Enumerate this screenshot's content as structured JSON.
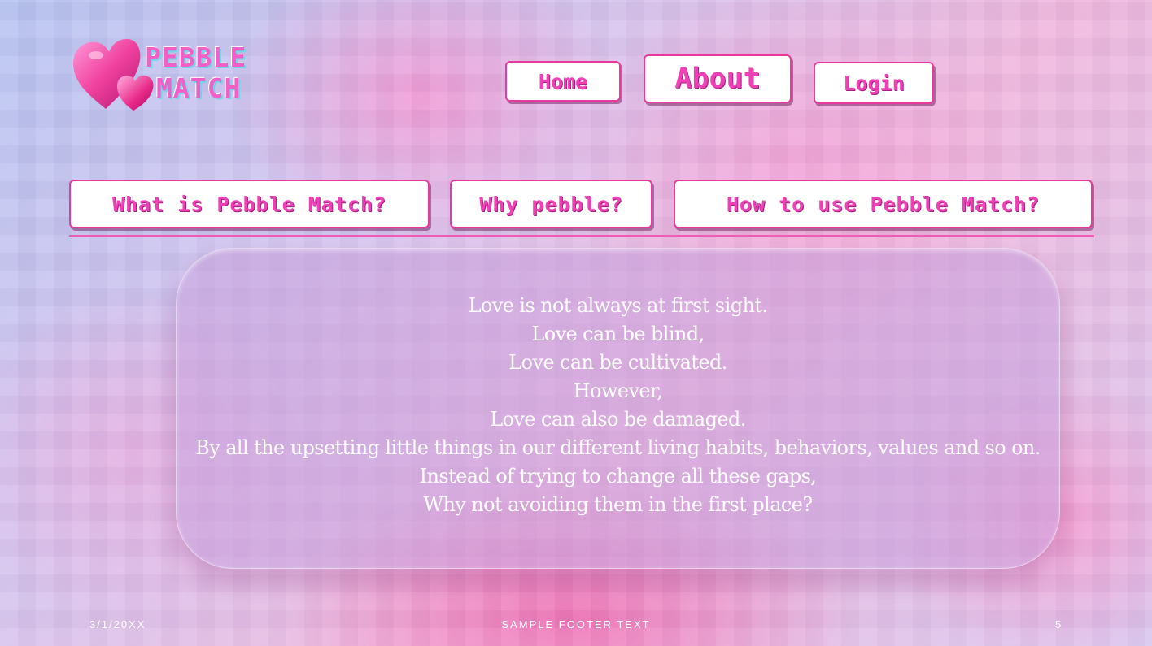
{
  "logo": {
    "line1": "PEBBLE",
    "line2": "MATCH",
    "icon": "double-heart-icon"
  },
  "nav": {
    "home": "Home",
    "about": "About",
    "login": "Login"
  },
  "tabs": [
    {
      "label": "What is Pebble Match?"
    },
    {
      "label": "Why pebble?"
    },
    {
      "label": "How to use Pebble Match?"
    }
  ],
  "poem": [
    "Love is not always at first sight.",
    "Love can be blind,",
    "Love can be cultivated.",
    "However,",
    "Love can also be damaged.",
    "By all the upsetting little things in our different living habits, behaviors, values and so on.",
    "Instead of trying to change all these gaps,",
    "Why not avoiding them in the first place?"
  ],
  "footer": {
    "date": "3/1/20XX",
    "text": "SAMPLE FOOTER TEXT",
    "page": "5"
  },
  "colors": {
    "accent": "#f040b8",
    "divider": "#ee5cb6",
    "panel": "#c8a0dc"
  }
}
